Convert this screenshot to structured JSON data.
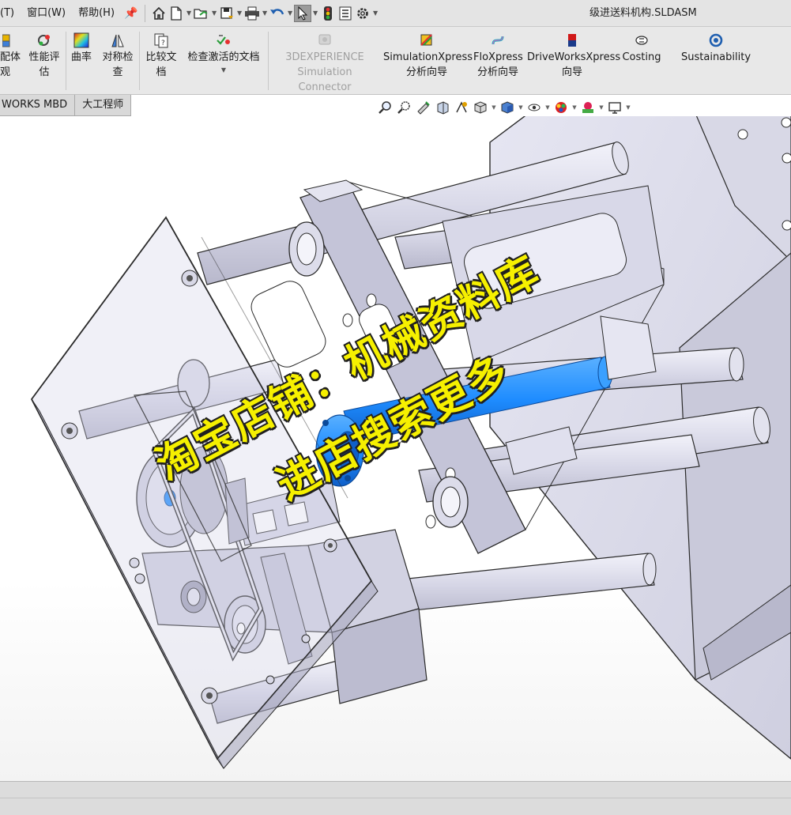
{
  "menu": {
    "items": [
      "(T)",
      "窗口(W)",
      "帮助(H)"
    ],
    "pin_icon": "pin-icon"
  },
  "quick_access": {
    "icons": [
      "home-icon",
      "new-document-icon",
      "open-icon",
      "save-icon",
      "print-icon",
      "undo-icon",
      "select-cursor-icon",
      "rebuild-traffic-light-icon",
      "file-properties-icon",
      "options-gear-icon"
    ]
  },
  "document": {
    "title": "级进送料机构.SLDASM"
  },
  "ribbon": {
    "items": [
      {
        "label1": "配体",
        "label2": "观",
        "icon": "assembly-visualization-icon"
      },
      {
        "label1": "性能评",
        "label2": "估",
        "icon": "performance-evaluation-icon"
      },
      {
        "label1": "曲率",
        "label2": "",
        "icon": "curvature-icon"
      },
      {
        "label1": "对称检",
        "label2": "查",
        "icon": "symmetry-check-icon"
      },
      {
        "label1": "比较文",
        "label2": "档",
        "icon": "compare-documents-icon"
      },
      {
        "label1": "检查激活的文档",
        "label2": "",
        "icon": "check-active-document-icon"
      },
      {
        "label1": "3DEXPERIENCE",
        "label2": "Simulation Connector",
        "icon": "simulation-connector-icon",
        "disabled": true
      },
      {
        "label1": "SimulationXpress",
        "label2": "分析向导",
        "icon": "simulationxpress-icon"
      },
      {
        "label1": "FloXpress",
        "label2": "分析向导",
        "icon": "floxpress-icon"
      },
      {
        "label1": "DriveWorksXpress",
        "label2": "向导",
        "icon": "driveworksxpress-icon"
      },
      {
        "label1": "",
        "label2": "Costing",
        "icon": "costing-icon"
      },
      {
        "label1": "Sustainability",
        "label2": "",
        "icon": "sustainability-icon"
      }
    ]
  },
  "tabs": [
    {
      "label": "WORKS MBD"
    },
    {
      "label": "大工程师"
    }
  ],
  "hud_icons": [
    "zoom-to-fit-icon",
    "zoom-to-area-icon",
    "previous-view-icon",
    "section-view-icon",
    "dynamic-annotation-icon",
    "view-orientation-icon",
    "display-style-icon",
    "hide-show-items-icon",
    "edit-appearance-icon",
    "apply-scene-icon",
    "view-settings-icon"
  ],
  "watermark": {
    "line1": "淘宝店铺：机械资料库",
    "line2": "进店搜索更多"
  },
  "colors": {
    "model_face": "#dcdcec",
    "model_edge": "#2a2a2a",
    "highlight": "#1e8cff",
    "watermark": "#f6f000",
    "toolbar_bg": "#e8e8e8"
  }
}
